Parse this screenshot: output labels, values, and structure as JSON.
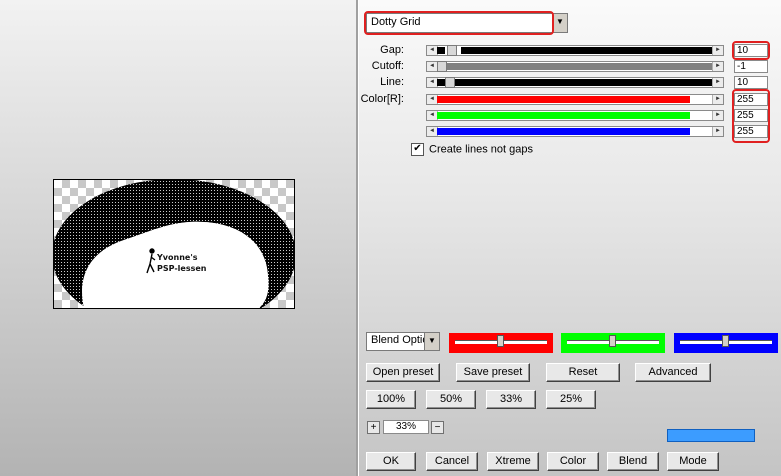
{
  "preview": {
    "watermark_line1": "Yvonne's",
    "watermark_line2": "PSP-lessen"
  },
  "filter": {
    "selected": "Dotty Grid"
  },
  "settings": {
    "gap": {
      "label": "Gap:",
      "value": "10"
    },
    "cutoff": {
      "label": "Cutoff:",
      "value": "-1"
    },
    "line": {
      "label": "Line:",
      "value": "10"
    },
    "color_r": {
      "label": "Color[R]:",
      "value": "255"
    },
    "color_g": {
      "value": "255"
    },
    "color_b": {
      "value": "255"
    },
    "create_lines": {
      "label": "Create lines not gaps",
      "checked": true
    }
  },
  "blend": {
    "selected": "Blend Optio"
  },
  "buttons": {
    "open_preset": "Open preset",
    "save_preset": "Save preset",
    "reset": "Reset",
    "advanced": "Advanced",
    "zoom_100": "100%",
    "zoom_50": "50%",
    "zoom_33": "33%",
    "zoom_25": "25%",
    "ok": "OK",
    "cancel": "Cancel",
    "xtreme": "Xtreme",
    "color": "Color",
    "blend": "Blend",
    "mode": "Mode"
  },
  "zoom": {
    "plus": "+",
    "value": "33%",
    "minus": "−"
  },
  "colors": {
    "red": "#ff0000",
    "green": "#00ff00",
    "blue": "#0000ff",
    "highlight": "#e02020",
    "status": "#3c9cff"
  }
}
